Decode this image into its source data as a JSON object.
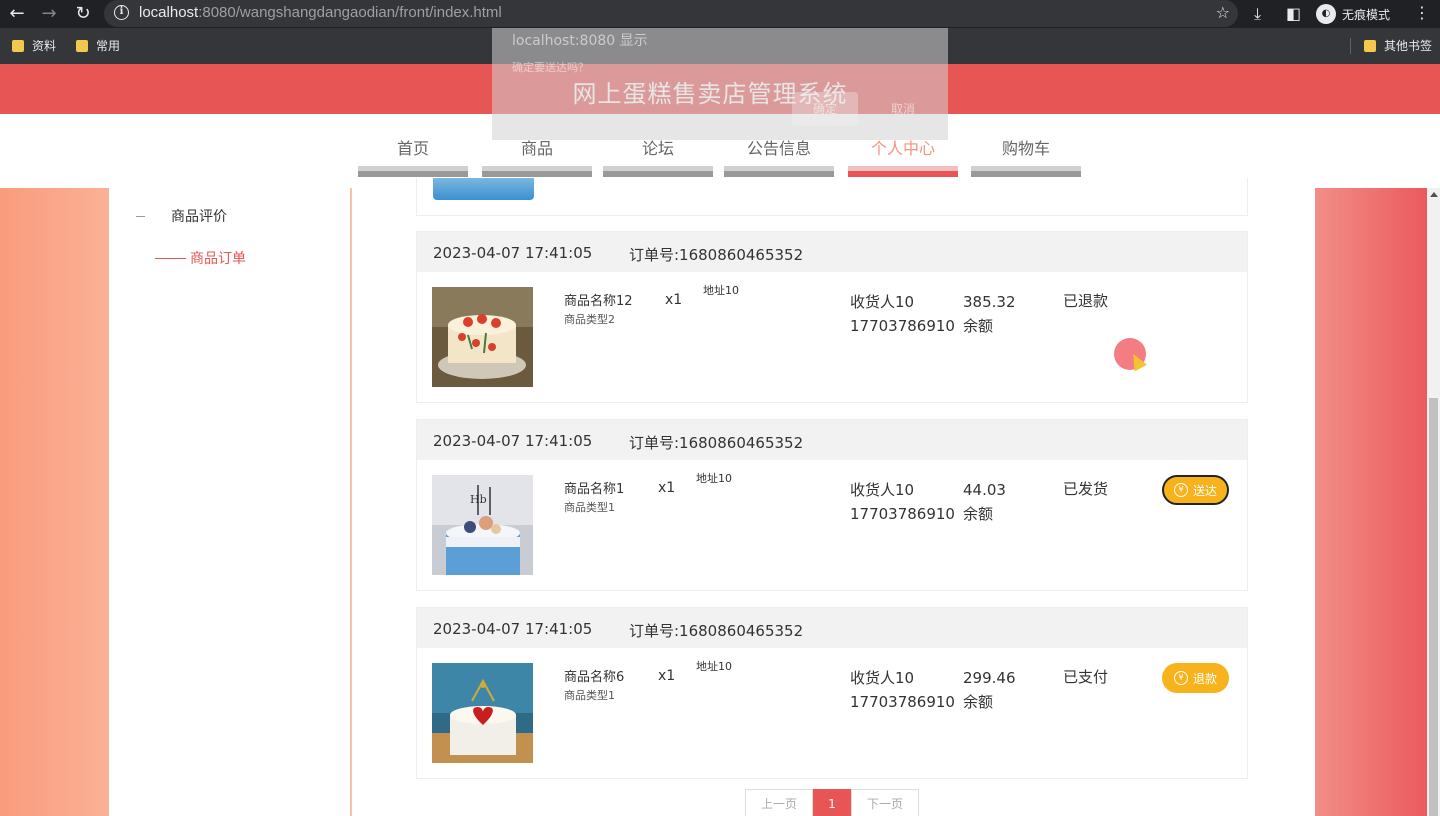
{
  "browser": {
    "url_host": "localhost",
    "url_rest": ":8080/wangshangdangaodian/front/index.html",
    "incognito_label": "无痕模式",
    "bookmarks": [
      "资料",
      "常用"
    ],
    "other_bookmarks": "其他书签"
  },
  "alert": {
    "title": "localhost:8080 显示",
    "message": "确定要送达吗？",
    "ok": "确定",
    "cancel": "取消"
  },
  "site": {
    "title": "网上蛋糕售卖店管理系统",
    "nav": [
      "首页",
      "商品",
      "论坛",
      "公告信息",
      "个人中心",
      "购物车"
    ],
    "active_nav": "个人中心"
  },
  "side_menu": {
    "items": [
      {
        "label": "商品评价"
      },
      {
        "label": "商品订单"
      }
    ],
    "active": "商品订单"
  },
  "orders": [
    {
      "time": "2023-04-07 17:41:05",
      "order_no": "订单号:1680860465352",
      "product_name": "商品名称12",
      "product_type": "商品类型2",
      "qty": "x1",
      "address": "地址10",
      "receiver": "收货人10",
      "phone": "17703786910",
      "price": "385.32",
      "pay_method": "余额",
      "status": "已退款",
      "action": ""
    },
    {
      "time": "2023-04-07 17:41:05",
      "order_no": "订单号:1680860465352",
      "product_name": "商品名称1",
      "product_type": "商品类型1",
      "qty": "x1",
      "address": "地址10",
      "receiver": "收货人10",
      "phone": "17703786910",
      "price": "44.03",
      "pay_method": "余额",
      "status": "已发货",
      "action": "送达"
    },
    {
      "time": "2023-04-07 17:41:05",
      "order_no": "订单号:1680860465352",
      "product_name": "商品名称6",
      "product_type": "商品类型1",
      "qty": "x1",
      "address": "地址10",
      "receiver": "收货人10",
      "phone": "17703786910",
      "price": "299.46",
      "pay_method": "余额",
      "status": "已支付",
      "action": "退款"
    }
  ],
  "pagination": {
    "prev": "上一页",
    "current": "1",
    "next": "下一页"
  },
  "colors": {
    "brand": "#e85555",
    "accent_button": "#f8b31c",
    "nav_active_text": "#f2957e"
  }
}
